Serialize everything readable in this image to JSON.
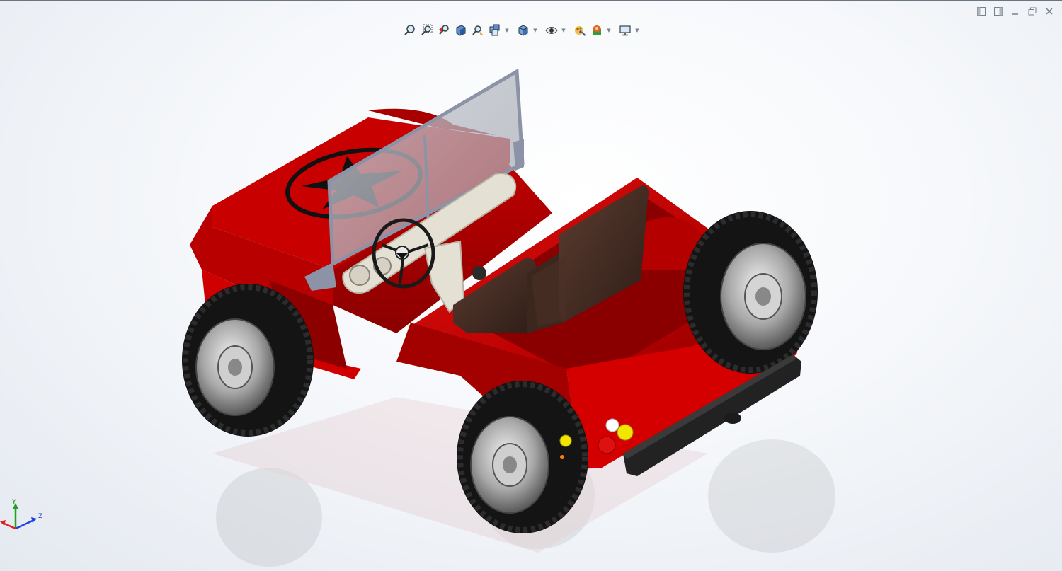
{
  "toolbar": {
    "items": [
      {
        "icon": "zoom-to-fit-icon"
      },
      {
        "icon": "zoom-to-area-icon"
      },
      {
        "icon": "previous-view-icon"
      },
      {
        "icon": "section-view-icon"
      },
      {
        "icon": "dynamic-annotation-views-icon"
      },
      {
        "icon": "view-orientation-icon",
        "dropdown": true
      },
      {
        "icon": "display-style-icon",
        "dropdown": true
      },
      {
        "icon": "hide-show-items-icon",
        "dropdown": true
      },
      {
        "icon": "edit-appearance-icon"
      },
      {
        "icon": "apply-scene-icon",
        "dropdown": true
      },
      {
        "icon": "view-settings-icon",
        "dropdown": true
      }
    ]
  },
  "window_controls": [
    "tile-left-icon",
    "tile-right-icon",
    "minimize-icon",
    "restore-icon",
    "close-icon"
  ],
  "triad": {
    "x": "",
    "y": "Y",
    "z": "Z"
  },
  "colors": {
    "body_red": "#c40000",
    "body_dark": "#7a0000",
    "seat": "#4a3026",
    "tire": "#141414",
    "rim": "#b9b9b9",
    "windshield_frame": "#8c93a6",
    "dash": "#e4e0d4",
    "triad_x": "#e02020",
    "triad_y": "#20a020",
    "triad_z": "#2040e0"
  }
}
